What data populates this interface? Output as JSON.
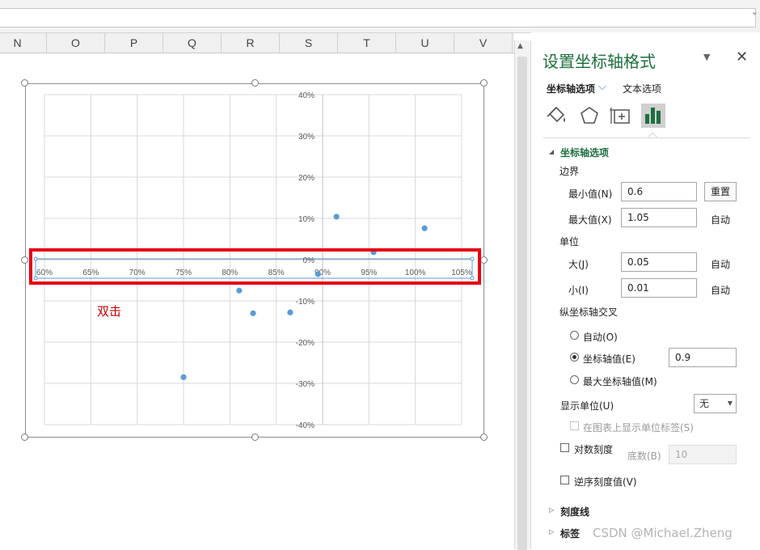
{
  "formula_bar": {
    "value": ""
  },
  "columns": [
    "N",
    "O",
    "P",
    "Q",
    "R",
    "S",
    "T",
    "U",
    "V"
  ],
  "chart_data": {
    "type": "scatter",
    "x": [
      0.75,
      0.81,
      0.825,
      0.865,
      0.895,
      0.915,
      0.955,
      1.01
    ],
    "y": [
      -0.285,
      -0.075,
      -0.13,
      -0.128,
      -0.035,
      0.104,
      0.018,
      0.076
    ],
    "x_ticks": [
      "60%",
      "65%",
      "70%",
      "75%",
      "80%",
      "85%",
      "90%",
      "95%",
      "100%",
      "105%"
    ],
    "y_ticks": [
      "40%",
      "30%",
      "20%",
      "10%",
      "0%",
      "-10%",
      "-20%",
      "-30%",
      "-40%"
    ],
    "xlim": [
      0.6,
      1.05
    ],
    "ylim": [
      -0.4,
      0.4
    ],
    "vertical_axis_crosses_at": 0.9,
    "grid": true,
    "colors": {
      "point": "#5b9bd5",
      "grid": "#d9d9d9",
      "axis": "#bfbfbf"
    }
  },
  "annotation": {
    "text": "双击",
    "frame_color": "#e60012"
  },
  "pane": {
    "title": "设置坐标轴格式",
    "tab_axis_options": "坐标轴选项",
    "tab_text_options": "文本选项",
    "icons": [
      "fill-line-icon",
      "effects-pentagon-icon",
      "size-properties-icon",
      "axis-options-bar-icon"
    ],
    "section_axis_options": "坐标轴选项",
    "bounds_label": "边界",
    "min_label": "最小值(N)",
    "min_value": "0.6",
    "reset_label": "重置",
    "max_label": "最大值(X)",
    "max_value": "1.05",
    "auto_label": "自动",
    "units_label": "单位",
    "major_label": "大(J)",
    "major_value": "0.05",
    "minor_label": "小(I)",
    "minor_value": "0.01",
    "vaxis_cross_label": "纵坐标轴交叉",
    "radio_auto": "自动(O)",
    "radio_axis_value": "坐标轴值(E)",
    "axis_value": "0.9",
    "radio_max": "最大坐标轴值(M)",
    "display_units_label": "显示单位(U)",
    "display_units_value": "无",
    "show_units_label": "在图表上显示单位标签(S)",
    "log_scale_label": "对数刻度",
    "base_label": "底数(B)",
    "base_value": "10",
    "reverse_label": "逆序刻度值(V)",
    "section_tick_marks": "刻度线",
    "section_labels": "标签"
  },
  "watermark": "CSDN @Michael.Zheng"
}
